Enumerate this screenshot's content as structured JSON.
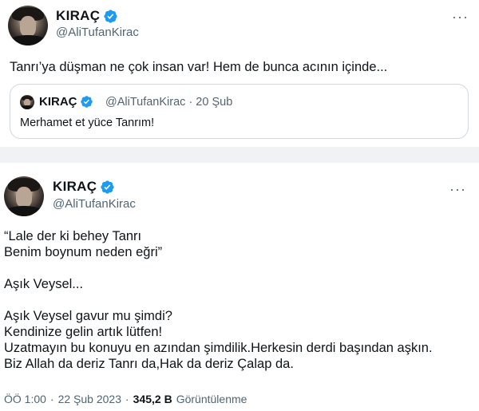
{
  "tweet1": {
    "author_name": "KIRAÇ",
    "author_handle": "@AliTufanKirac",
    "more_label": "···",
    "text": "Tanrı’ya düşman ne çok insan var! Hem de bunca acının içinde...",
    "quote": {
      "author_name": "KIRAÇ",
      "author_handle": "@AliTufanKirac · 20 Şub",
      "text": "Merhamet et yüce Tanrım!"
    }
  },
  "tweet2": {
    "author_name": "KIRAÇ",
    "author_handle": "@AliTufanKirac",
    "more_label": "···",
    "lines": [
      "“Lale der ki behey Tanrı",
      "Benim boynum neden eğri”",
      "",
      "Aşık Veysel...",
      "",
      "Aşık Veysel gavur mu şimdi?",
      "Kendinize gelin artık lütfen!",
      "Uzatmayın bu konuyu en azından şimdilik.Herkesin derdi başından aşkın.",
      "Biz Allah da deriz Tanrı da,Hak da deriz Çalap da."
    ],
    "meta": {
      "time": "ÖÖ 1:00",
      "separator": "·",
      "date": "22 Şub 2023",
      "separator2": "·",
      "views_count": "345,2 B",
      "views_label": "Görüntülenme"
    }
  },
  "colors": {
    "verified_blue": "#1d9bf0",
    "secondary_text": "#536471",
    "divider_gap": "#f0f2f4"
  },
  "icons": {
    "verified": "verified-badge-icon",
    "more": "more-options-icon"
  }
}
